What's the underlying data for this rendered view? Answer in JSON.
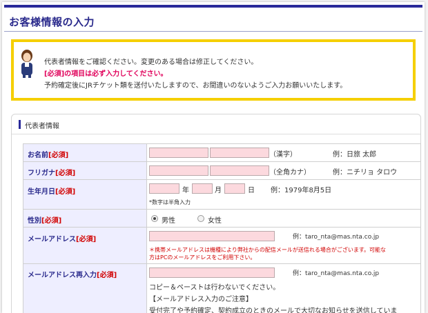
{
  "page": {
    "title": "お客様情報の入力"
  },
  "notice": {
    "line1": "代表者情報をご確認ください。変更のある場合は修正してください。",
    "line2": "[必須]の項目は必ず入力してください。",
    "line3": "予約確定後にJRチケット類を送付いたしますので、お間違いのないようご入力お願いいたします。"
  },
  "panel": {
    "title": "代表者情報"
  },
  "form": {
    "required_tag": "[必須]",
    "name": {
      "label": "お名前",
      "suffix": "（漢字）",
      "example": "例：日旅 太郎",
      "last_value": "",
      "first_value": ""
    },
    "kana": {
      "label": "フリガナ",
      "suffix": "（全角カナ）",
      "example": "例：ニチリョ タロウ",
      "last_value": "",
      "first_value": ""
    },
    "birth": {
      "label": "生年月日",
      "year_unit": "年",
      "month_unit": "月",
      "day_unit": "日",
      "example": "例：1979年8月5日",
      "note": "*数字は半角入力"
    },
    "gender": {
      "label": "性別",
      "male": "男性",
      "female": "女性",
      "selected": "男性"
    },
    "email": {
      "label": "メールアドレス",
      "example": "例：taro_nta@mas.nta.co.jp",
      "warning1": "＊携帯メールアドレスは機種により弊社からの配信メールが送信れる場合がございます。可能な",
      "warning2": "方はPCのメールアドレスをご利用下さい。"
    },
    "email_confirm": {
      "label": "メールアドレス再入力",
      "example": "例：taro_nta@mas.nta.co.jp",
      "note1": "コピー＆ペーストは行わないでください。",
      "note2": "【メールアドレス入力のご注意】",
      "note3": "受付完了や予約確定、契約成立のときのメールで大切なお知らせを送信していま"
    }
  }
}
